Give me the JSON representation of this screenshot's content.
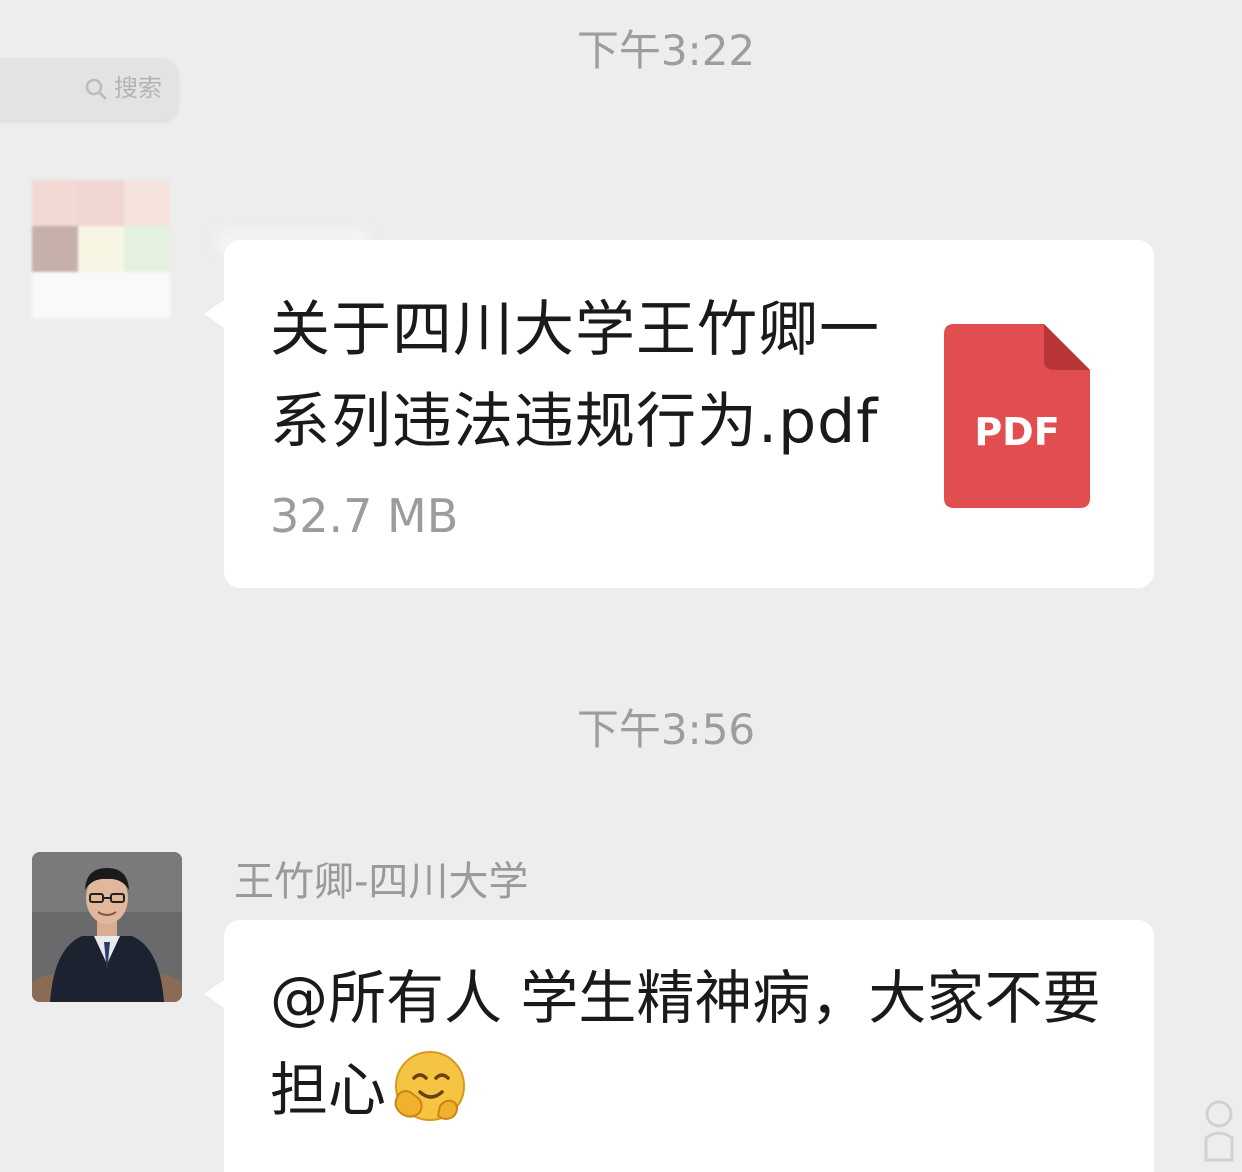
{
  "search": {
    "label": "搜索",
    "icon": "search-icon"
  },
  "messages": {
    "timestamp_1": "下午3:22",
    "file": {
      "name": "关于四川大学王竹卿一系列违法违规行为.pdf",
      "size": "32.7 MB",
      "type_label": "PDF",
      "icon": "pdf-file-icon",
      "icon_color": "#e24d4f"
    },
    "timestamp_2": "下午3:56",
    "sender_name": "王竹卿-四川大学",
    "text": "@所有人  学生精神病，大家不要担心",
    "emoji": "hugging-face-emoji"
  },
  "colors": {
    "background": "#ededed",
    "bubble": "#ffffff",
    "timestamp": "#9d9d9d"
  }
}
